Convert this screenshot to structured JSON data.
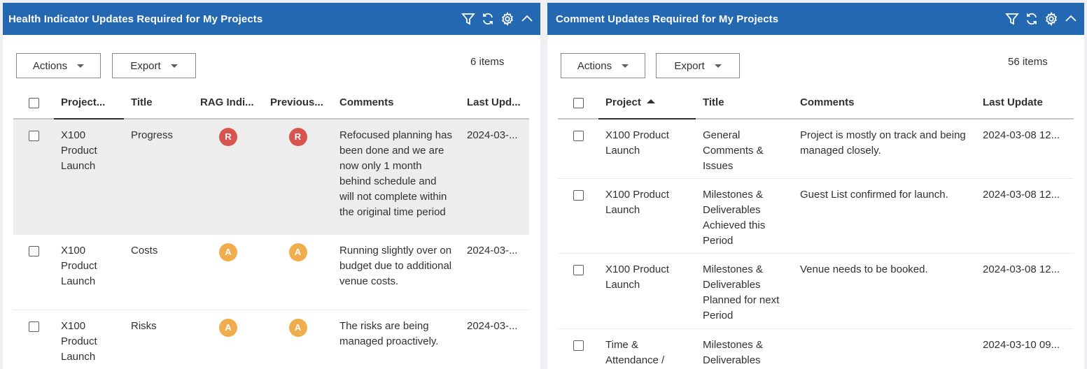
{
  "left_panel": {
    "title": "Health Indicator Updates Required for My Projects",
    "actions_label": "Actions",
    "export_label": "Export",
    "item_count": "6 items",
    "columns": [
      "Project...",
      "Title",
      "RAG Indi...",
      "Previous...",
      "Comments",
      "Last Upd..."
    ],
    "rows": [
      {
        "project": "X100 Product Launch",
        "title": "Progress",
        "rag": "R",
        "previous": "R",
        "comments": "Refocused planning has been done and we are now only 1 month behind schedule and will not complete within the original time period",
        "last_update": "2024-03-..."
      },
      {
        "project": "X100 Product Launch",
        "title": "Costs",
        "rag": "A",
        "previous": "A",
        "comments": "Running slightly over on budget due to additional venue costs.",
        "last_update": "2024-03-..."
      },
      {
        "project": "X100 Product Launch",
        "title": "Risks",
        "rag": "A",
        "previous": "A",
        "comments": "The risks are being managed proactively.",
        "last_update": "2024-03-..."
      }
    ]
  },
  "right_panel": {
    "title": "Comment Updates Required for My Projects",
    "actions_label": "Actions",
    "export_label": "Export",
    "item_count": "56 items",
    "columns": [
      "Project",
      "Title",
      "Comments",
      "Last Update"
    ],
    "rows": [
      {
        "project": "X100 Product Launch",
        "title": "General Comments & Issues",
        "comments": "Project is mostly on track and being managed closely.",
        "last_update": "2024-03-08 12..."
      },
      {
        "project": "X100 Product Launch",
        "title": "Milestones & Deliverables Achieved this Period",
        "comments": "Guest List confirmed for launch.",
        "last_update": "2024-03-08 12..."
      },
      {
        "project": "X100 Product Launch",
        "title": "Milestones & Deliverables Planned for next Period",
        "comments": "Venue needs to be booked.",
        "last_update": "2024-03-08 12..."
      },
      {
        "project": "Time & Attendance /",
        "title": "Milestones & Deliverables",
        "comments": "",
        "last_update": "2024-03-10 09..."
      }
    ]
  },
  "colors": {
    "header_bg": "#2368b0",
    "rag_red": "#d9534f",
    "rag_amber": "#f0ad4e",
    "selected_row": "#ededed"
  },
  "icons": [
    "filter-icon",
    "refresh-icon",
    "gear-icon",
    "chevron-up-icon"
  ]
}
